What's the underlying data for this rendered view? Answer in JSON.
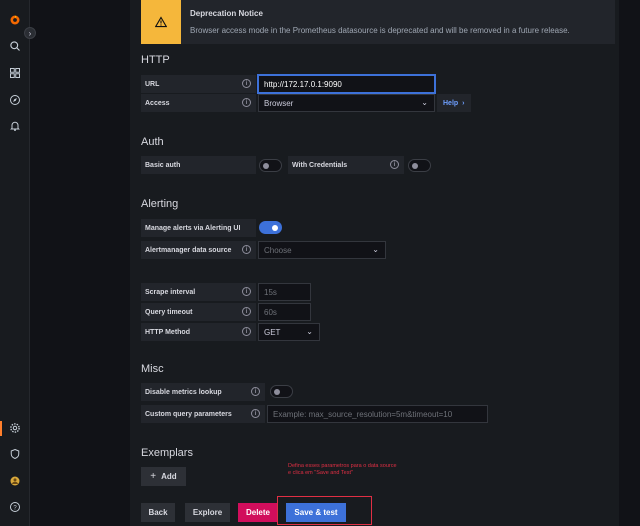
{
  "notice": {
    "title": "Deprecation Notice",
    "text": "Browser access mode in the Prometheus datasource is deprecated and will be removed in a future release."
  },
  "http": {
    "section_title": "HTTP",
    "url_label": "URL",
    "url_value": "http://172.17.0.1:9090",
    "access_label": "Access",
    "access_value": "Browser",
    "help_label": "Help"
  },
  "auth": {
    "section_title": "Auth",
    "basic_auth_label": "Basic auth",
    "basic_auth_on": false,
    "with_credentials_label": "With Credentials",
    "with_credentials_on": false
  },
  "alerting": {
    "section_title": "Alerting",
    "manage_alerts_label": "Manage alerts via Alerting UI",
    "manage_alerts_on": true,
    "alertmanager_label": "Alertmanager data source",
    "alertmanager_placeholder": "Choose"
  },
  "scrape": {
    "scrape_interval_label": "Scrape interval",
    "scrape_interval_placeholder": "15s",
    "query_timeout_label": "Query timeout",
    "query_timeout_placeholder": "60s",
    "http_method_label": "HTTP Method",
    "http_method_value": "GET"
  },
  "misc": {
    "section_title": "Misc",
    "disable_metrics_label": "Disable metrics lookup",
    "disable_metrics_on": false,
    "custom_query_label": "Custom query parameters",
    "custom_query_placeholder": "Example: max_source_resolution=5m&timeout=10"
  },
  "exemplars": {
    "section_title": "Exemplars",
    "add_label": "Add"
  },
  "actions": {
    "back_label": "Back",
    "explore_label": "Explore",
    "delete_label": "Delete",
    "save_label": "Save & test"
  },
  "annotation": {
    "line1": "Defina esses parametros para o data source",
    "line2": "e clica em \"Save and Test\""
  },
  "colors": {
    "accent": "#3d71d9",
    "danger": "#d10e5c",
    "warning": "#f5b73b",
    "annotation": "#e02f44"
  },
  "icons": [
    "grafana-logo-icon",
    "search-icon",
    "dashboards-icon",
    "explore-compass-icon",
    "alert-bell-icon",
    "gear-icon",
    "shield-icon",
    "user-avatar-icon",
    "help-icon"
  ]
}
